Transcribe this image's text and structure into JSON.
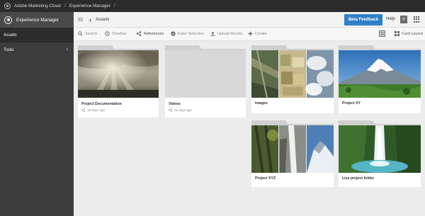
{
  "topbar": {
    "app_name": "Adobe Marketing Cloud",
    "section": "Experience Manager",
    "separator": "/"
  },
  "sidebar": {
    "title": "Experience Manager",
    "items": [
      {
        "label": "Assets",
        "active": true
      },
      {
        "label": "Tools",
        "active": false
      }
    ]
  },
  "header": {
    "title": "Assets",
    "beta_label": "Beta Feedback",
    "help_label": "Help",
    "notification_count": "0"
  },
  "toolbar": {
    "search": "Search",
    "timeline": "Timeline",
    "references": "References",
    "enter_selection": "Enter Selection",
    "upload": "Upload Assets",
    "create": "Create",
    "layout": "Card Layout"
  },
  "cards": [
    {
      "name": "Project Documentation",
      "time": "19 days ago",
      "thumb": "sky-icon"
    },
    {
      "name": "Videos",
      "time": "16 days ago",
      "thumb": "empty"
    },
    {
      "name": "Images",
      "time": "",
      "thumb": "collage-icon"
    },
    {
      "name": "Project XY",
      "time": "",
      "thumb": "mountain-icon"
    },
    {
      "name": "Project XYZ",
      "time": "",
      "thumb": "collage2-icon"
    },
    {
      "name": "Lisa project folder",
      "time": "",
      "thumb": "waterfall-icon"
    }
  ],
  "colors": {
    "accent": "#2d80c8",
    "topbar": "#2b2b2b",
    "sidebar": "#3c3c3c",
    "canvas": "#ececec"
  }
}
